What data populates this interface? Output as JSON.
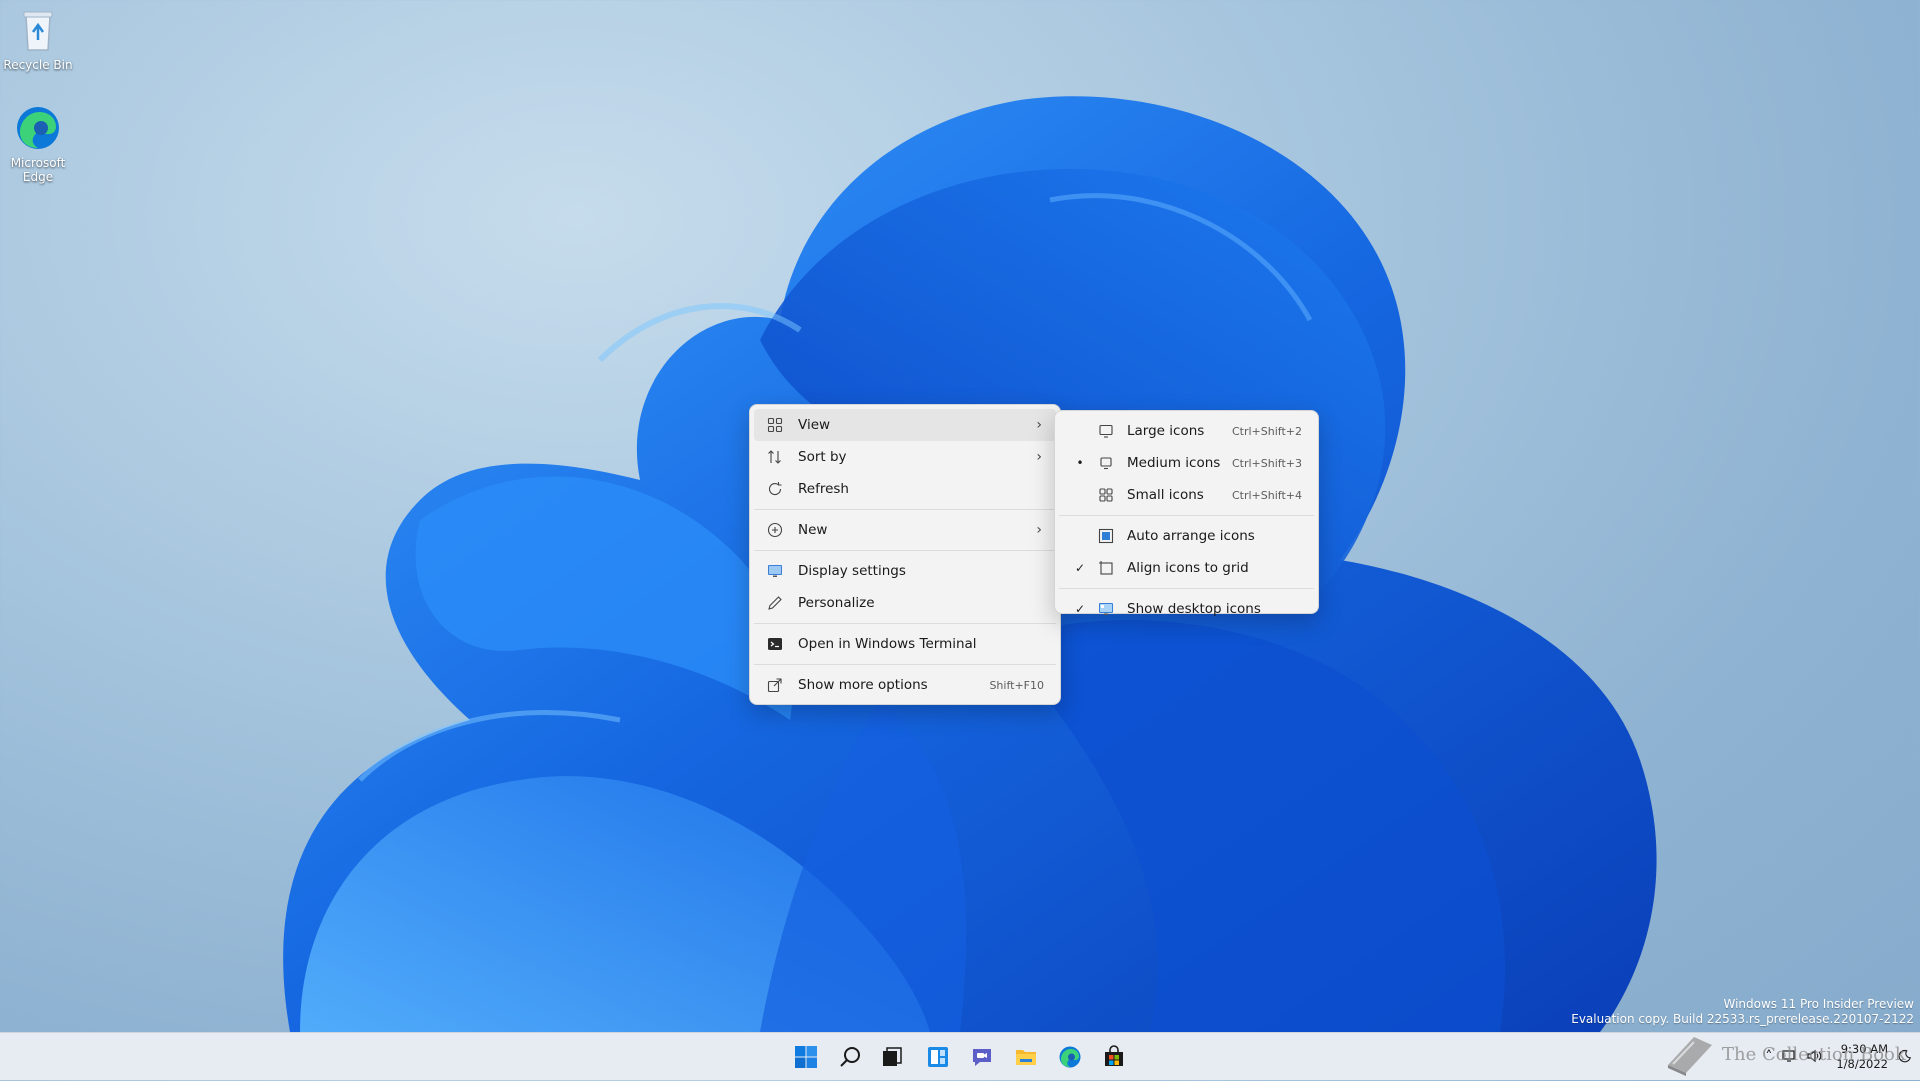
{
  "desktop": {
    "icons": [
      {
        "label": "Recycle Bin",
        "icon": "recycle-bin-icon"
      },
      {
        "label": "Microsoft Edge",
        "icon": "edge-icon"
      }
    ]
  },
  "context_menu": {
    "items": [
      {
        "label": "View",
        "icon": "grid-icon",
        "submenu": true
      },
      {
        "label": "Sort by",
        "icon": "sort-icon",
        "submenu": true
      },
      {
        "label": "Refresh",
        "icon": "refresh-icon"
      },
      {
        "label": "New",
        "icon": "plus-circle-icon",
        "submenu": true
      },
      {
        "label": "Display settings",
        "icon": "display-icon"
      },
      {
        "label": "Personalize",
        "icon": "pen-icon"
      },
      {
        "label": "Open in Windows Terminal",
        "icon": "terminal-icon"
      },
      {
        "label": "Show more options",
        "icon": "share-icon",
        "shortcut": "Shift+F10"
      }
    ]
  },
  "view_submenu": {
    "items": [
      {
        "label": "Large icons",
        "shortcut": "Ctrl+Shift+2",
        "mark": ""
      },
      {
        "label": "Medium icons",
        "shortcut": "Ctrl+Shift+3",
        "mark": "•"
      },
      {
        "label": "Small icons",
        "shortcut": "Ctrl+Shift+4",
        "mark": ""
      },
      {
        "label": "Auto arrange icons",
        "mark": ""
      },
      {
        "label": "Align icons to grid",
        "mark": "✓"
      },
      {
        "label": "Show desktop icons",
        "mark": "✓"
      }
    ]
  },
  "watermark": {
    "line1": "Windows 11 Pro Insider Preview",
    "line2": "Evaluation copy. Build 22533.rs_prerelease.220107-2122"
  },
  "taskbar": {
    "time": "9:30 AM",
    "date": "1/8/2022",
    "corner_text": "The Collection Book"
  },
  "colors": {
    "accent": "#0067c0",
    "menu_bg": "#f3f3f3"
  }
}
